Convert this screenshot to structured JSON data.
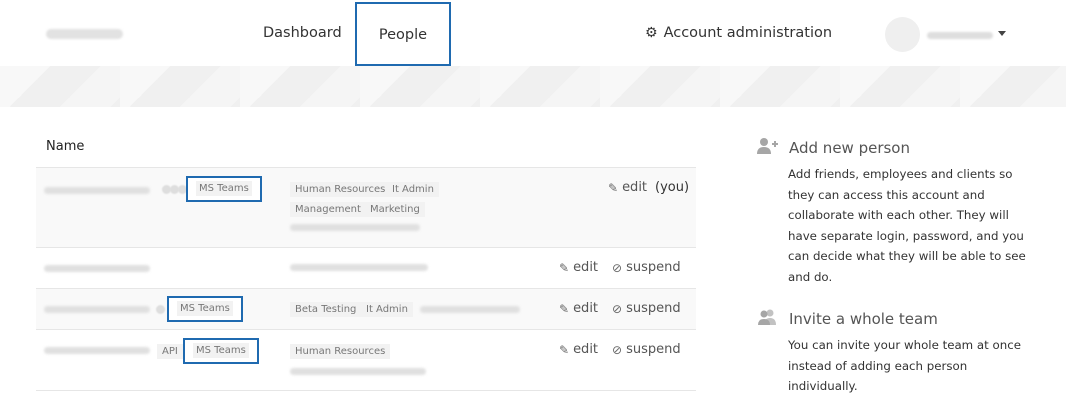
{
  "nav": {
    "dashboard": "Dashboard",
    "people": "People",
    "account_admin": "Account administration"
  },
  "table": {
    "header_name": "Name",
    "rows": [
      {
        "tags_boxed": [
          "MS Teams"
        ],
        "groups": [
          "Human Resources",
          "It Admin",
          "Management",
          "Marketing"
        ],
        "actions": [
          "edit"
        ],
        "you_label": "(you)"
      },
      {
        "actions": [
          "edit",
          "suspend"
        ]
      },
      {
        "tags_boxed": [
          "MS Teams"
        ],
        "groups": [
          "Beta Testing",
          "It Admin"
        ],
        "actions": [
          "edit",
          "suspend"
        ]
      },
      {
        "tags": [
          "API"
        ],
        "tags_boxed": [
          "MS Teams"
        ],
        "groups": [
          "Human Resources"
        ],
        "actions": [
          "edit",
          "suspend"
        ]
      }
    ]
  },
  "sidebar": {
    "add_person": {
      "title": "Add new person",
      "text": "Add friends, employees and clients so they can access this account and collaborate with each other. They will have separate login, password, and you can decide what they will be able to see and do."
    },
    "invite_team": {
      "title": "Invite a whole team",
      "text": "You can invite your whole team at once instead of adding each person individually."
    }
  },
  "icons": {
    "gear": "gear-icon",
    "pencil": "pencil-icon",
    "suspend": "ban-icon",
    "add_person": "user-plus-icon",
    "team": "users-icon"
  },
  "colors": {
    "highlight_box": "#1f6ab0",
    "hero_band": "#f0f0f0",
    "row_alt": "#f9f9f9"
  }
}
